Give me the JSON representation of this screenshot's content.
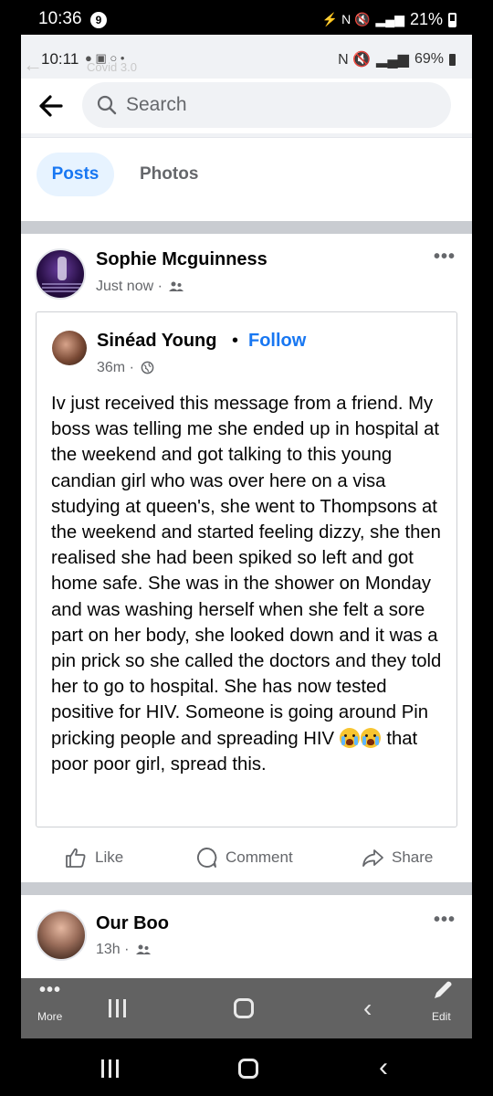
{
  "outer_status": {
    "time": "10:36",
    "badge": "9",
    "battery": "21%",
    "icons": "⚡ N 🔇"
  },
  "inner_status": {
    "time": "10:11",
    "icons": "● ▣ ○ •",
    "ghost_text": "Covid 3.0",
    "battery": "69%",
    "icons_right": "N 🔇"
  },
  "search": {
    "placeholder": "Search"
  },
  "tabs": {
    "posts": "Posts",
    "photos": "Photos"
  },
  "post": {
    "author": "Sophie Mcguinness",
    "time": "Just now ·",
    "more": "•••",
    "shared": {
      "author": "Sinéad Young",
      "dot": "•",
      "follow": "Follow",
      "time": "36m ·",
      "text_main": "Iv just received this message from a friend. My boss was telling me she ended up in hospital at the weekend and got talking to this young candian girl who was over here on a visa studying at queen's, she went to Thompsons at the weekend and started feeling dizzy, she then realised she had been spiked so left and got home safe. She was in the shower on Monday and was washing herself when she felt a sore part on her body, she looked down and it was a pin prick so she called the doctors and they told her to go to hospital. She has now tested positive for HIV. Someone is going around Pin pricking people and spreading HIV ",
      "text_end": " that poor poor girl, spread this."
    },
    "actions": {
      "like": "Like",
      "comment": "Comment",
      "share": "Share"
    }
  },
  "post2": {
    "author": "Our Boo",
    "time": "13h ·",
    "more": "•••"
  },
  "inner_nav": {
    "more_label": "More",
    "edit_label": "Edit",
    "more_dots": "•••",
    "back": "‹"
  },
  "outer_nav": {
    "back": "‹"
  },
  "colors": {
    "accent": "#1877f2",
    "tab_bg": "#e7f3ff",
    "text": "#050505",
    "muted": "#65676b"
  }
}
